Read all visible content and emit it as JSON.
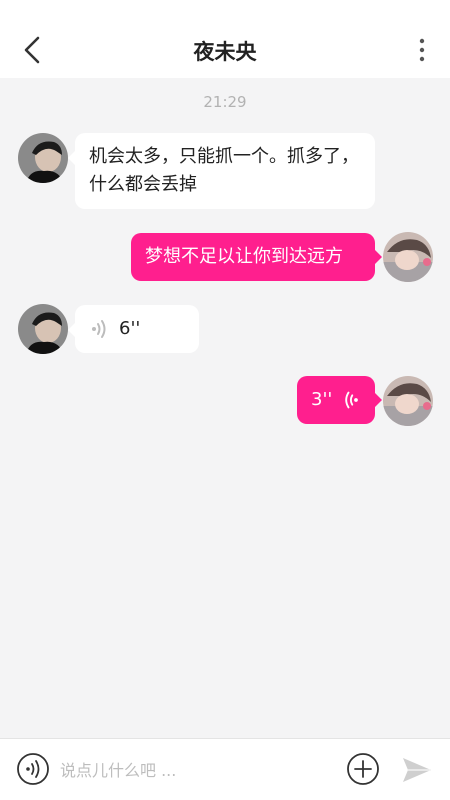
{
  "header": {
    "title": "夜未央",
    "back_icon": "chevron-left-icon",
    "more_icon": "more-vertical-icon"
  },
  "chat": {
    "timestamp": "21:29",
    "messages": [
      {
        "side": "left",
        "type": "text",
        "text": "机会太多，只能抓一个。抓多了，什么都会丢掉"
      },
      {
        "side": "right",
        "type": "text",
        "text": "梦想不足以让你到达远方"
      },
      {
        "side": "left",
        "type": "voice",
        "duration": "6''"
      },
      {
        "side": "right",
        "type": "voice",
        "duration": "3''"
      }
    ]
  },
  "input_bar": {
    "placeholder": "说点儿什么吧 ...",
    "value": "",
    "voice_icon": "voice-toggle-icon",
    "plus_icon": "plus-circle-icon",
    "send_icon": "send-icon"
  },
  "colors": {
    "accent": "#ff1f8e",
    "background": "#f4f4f5",
    "bubble_left": "#ffffff",
    "timestamp": "#b2b2b2"
  }
}
